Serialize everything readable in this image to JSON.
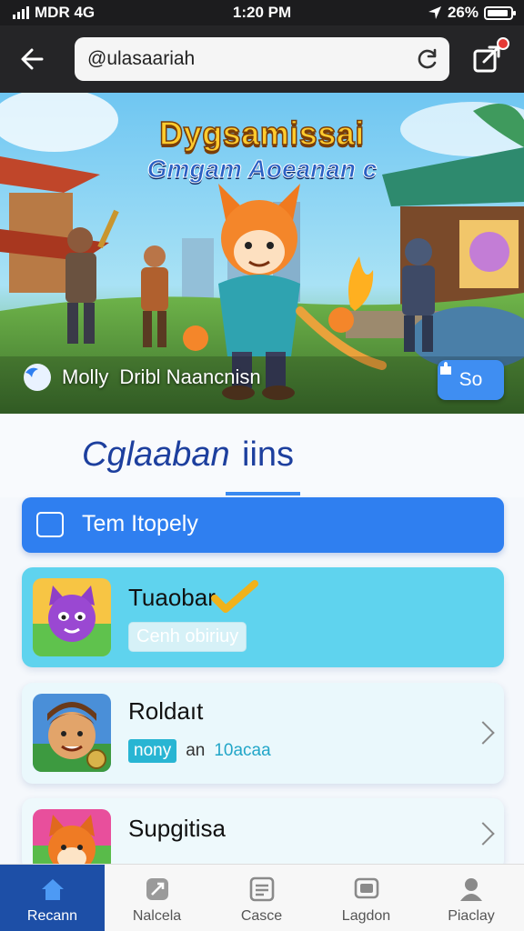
{
  "status_bar": {
    "carrier": "MDR 4G",
    "time": "1:20 PM",
    "battery": "26%"
  },
  "url_bar": {
    "value": "@ulasaariah"
  },
  "hero": {
    "title": "Dygsamissai",
    "subtitle": "Gmgam Aoeanan c",
    "author": "Molly",
    "author_detail": "Dribl Naancnisn",
    "button_label": "So"
  },
  "tabs": [
    {
      "label": "Cglaaban",
      "active": false
    },
    {
      "label": "iins",
      "active": true
    }
  ],
  "section": {
    "label": "Tem Itopely"
  },
  "cards": [
    {
      "title": "Tuaobar",
      "pill": "Cenh obiriuy"
    },
    {
      "title": "Roldaıt",
      "tag": "nony",
      "word": "an",
      "accent": "10acaa"
    },
    {
      "title": "Supgitisa"
    }
  ],
  "nav": [
    {
      "label": "Recann",
      "icon": "home-icon",
      "active": true
    },
    {
      "label": "Nalcela",
      "icon": "rocket-icon",
      "active": false
    },
    {
      "label": "Casce",
      "icon": "document-icon",
      "active": false
    },
    {
      "label": "Lagdon",
      "icon": "tv-icon",
      "active": false
    },
    {
      "label": "Piaclay",
      "icon": "person-icon",
      "active": false
    }
  ],
  "colors": {
    "accent": "#2f7ff0",
    "nav_active": "#1d4fa7",
    "card_highlight": "#5fd3ee"
  }
}
